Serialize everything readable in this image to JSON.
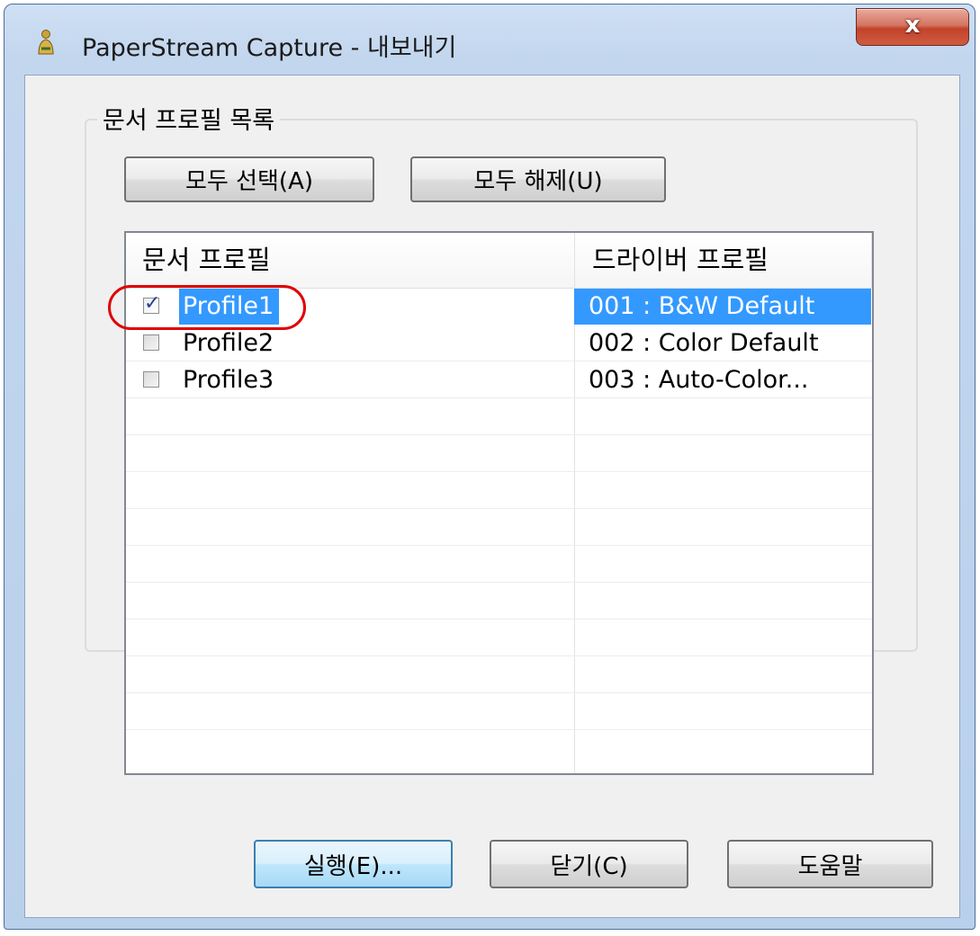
{
  "window": {
    "title": "PaperStream Capture - 내보내기",
    "close_label": "x",
    "icon": "paperstream-app-icon"
  },
  "group": {
    "label": "문서 프로필 목록",
    "select_all_label": "모두 선택(A)",
    "deselect_all_label": "모두 해제(U)"
  },
  "list": {
    "columns": [
      "문서 프로필",
      "드라이버 프로필"
    ],
    "rows": [
      {
        "name": "Profile1",
        "driver": "001 : B&W Default",
        "checked": true,
        "selected": true
      },
      {
        "name": "Profile2",
        "driver": "002 : Color Default",
        "checked": false,
        "selected": false
      },
      {
        "name": "Profile3",
        "driver": "003 : Auto-Color...",
        "checked": false,
        "selected": false
      }
    ]
  },
  "footer": {
    "run_label": "실행(E)...",
    "close_label": "닫기(C)",
    "help_label": "도움말"
  },
  "colors": {
    "selection": "#3399ff",
    "callout_ring": "#e00000"
  }
}
